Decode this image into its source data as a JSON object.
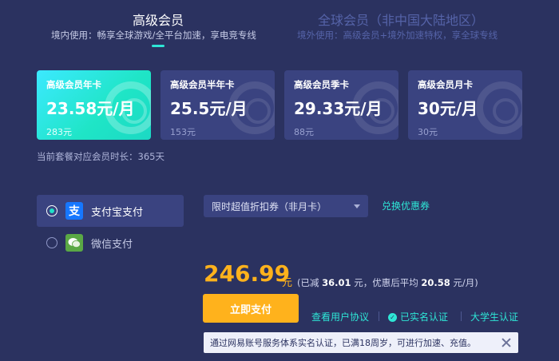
{
  "tabs": [
    {
      "title": "高级会员",
      "subtitle": "境内使用：畅享全球游戏/全平台加速，享电竞专线",
      "active": true
    },
    {
      "title": "全球会员（非中国大陆地区）",
      "subtitle": "境外使用：高级会员+境外加速特权，享全球专线",
      "active": false
    }
  ],
  "plans": [
    {
      "name": "高级会员年卡",
      "price": "23.58元/月",
      "total": "283元",
      "selected": true
    },
    {
      "name": "高级会员半年卡",
      "price": "25.5元/月",
      "total": "153元",
      "selected": false
    },
    {
      "name": "高级会员季卡",
      "price": "29.33元/月",
      "total": "88元",
      "selected": false
    },
    {
      "name": "高级会员月卡",
      "price": "30元/月",
      "total": "30元",
      "selected": false
    }
  ],
  "duration_text": "当前套餐对应会员时长：365天",
  "payment": {
    "alipay": {
      "label": "支付宝支付",
      "icon": "alipay-icon",
      "glyph": "支",
      "color": "#1677ff",
      "selected": true
    },
    "wechat": {
      "label": "微信支付",
      "icon": "wechat-icon",
      "color": "#5aa845",
      "selected": false
    }
  },
  "coupon": {
    "value": "限时超值折扣券（非月卡）",
    "exchange_label": "兑换优惠券"
  },
  "price": {
    "amount": "246.99",
    "unit": "元",
    "discount_prefix": "(已减",
    "discount_value": "36.01",
    "discount_unit": "元，优惠后平均",
    "avg_value": "20.58",
    "avg_unit": "元/月)"
  },
  "pay_button": "立即支付",
  "links": {
    "agreement": "查看用户协议",
    "verified": "已实名认证",
    "student": "大学生认证"
  },
  "notice": "通过网易账号服务体系实名认证，已满18周岁，可进行加速、充值。",
  "colors": {
    "background": "#2b3260",
    "accent": "#2ee6d6",
    "price": "#ffb21c",
    "card": "#3a4380"
  }
}
